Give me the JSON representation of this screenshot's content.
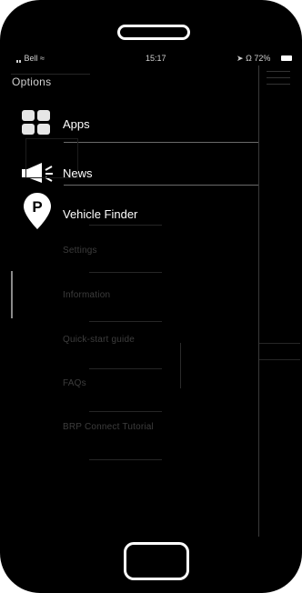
{
  "status": {
    "carrier": "Bell",
    "time": "15:17",
    "battery": "72%"
  },
  "drawer": {
    "title": "Options",
    "items": [
      {
        "label": "Apps",
        "icon": "apps-grid-icon",
        "emphasis": "primary"
      },
      {
        "label": "News",
        "icon": "megaphone-icon",
        "emphasis": "primary"
      },
      {
        "label": "Vehicle Finder",
        "icon": "parking-pin-icon",
        "emphasis": "primary"
      },
      {
        "label": "Settings",
        "emphasis": "dim"
      },
      {
        "label": "Information",
        "emphasis": "dim"
      },
      {
        "label": "Quick-start guide",
        "emphasis": "dim"
      },
      {
        "label": "FAQs",
        "emphasis": "dim"
      },
      {
        "label": "BRP Connect Tutorial",
        "emphasis": "dim"
      }
    ]
  },
  "colors": {
    "background": "#000000",
    "text_primary": "#ffffff",
    "text_dim": "#3d3d3d"
  }
}
